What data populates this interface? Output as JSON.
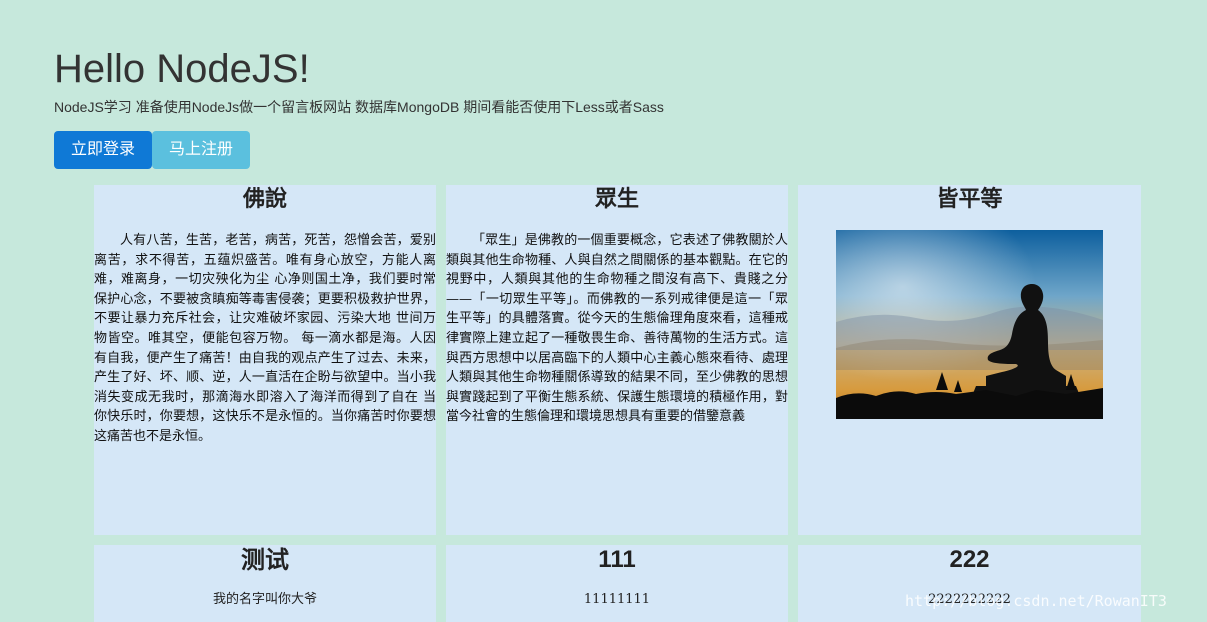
{
  "hero": {
    "title": "Hello NodeJS!",
    "subtitle": "NodeJS学习 准备使用NodeJs做一个留言板网站 数据库MongoDB 期间看能否使用下Less或者Sass"
  },
  "buttons": {
    "login": "立即登录",
    "register": "马上注册"
  },
  "colors": {
    "background": "#c6e8dc",
    "card": "#d5e7f7",
    "primary": "#0f79d6",
    "info": "#5bc0de"
  },
  "cards": [
    {
      "title": "佛說",
      "text": "人有八苦，生苦，老苦，病苦，死苦，怨憎会苦，爱别离苦，求不得苦，五蕴炽盛苦。唯有身心放空，方能人离难，难离身，一切灾殃化为尘  心净则国土净，我们要时常保护心念，不要被贪瞋痴等毒害侵袭；更要积极救护世界，不要让暴力充斥社会，让灾难破坏家园、污染大地  世间万物皆空。唯其空，便能包容万物。  每一滴水都是海。人因有自我，便产生了痛苦！由自我的观点产生了过去、未来，产生了好、坏、顺、逆，人一直活在企盼与欲望中。当小我消失变成无我时，那滴海水即溶入了海洋而得到了自在  当你快乐时，你要想，这快乐不是永恒的。当你痛苦时你要想这痛苦也不是永恒。"
    },
    {
      "title": "眾生",
      "text": "「眾生」是佛教的一個重要概念，它表述了佛教關於人類與其他生命物種、人與自然之間關係的基本觀點。在它的視野中，人類與其他的生命物種之間沒有高下、貴賤之分——「一切眾生平等」。而佛教的一系列戒律便是這一「眾生平等」的具體落實。從今天的生態倫理角度來看，這種戒律實際上建立起了一種敬畏生命、善待萬物的生活方式。這與西方思想中以居高臨下的人類中心主義心態來看待、處理人類與其他生命物種關係導致的結果不同，至少佛教的思想與實踐起到了平衡生態系統、保護生態環境的積極作用，對當今社會的生態倫理和環境思想具有重要的借鑒意義"
    },
    {
      "title": "皆平等",
      "image_alt": "buddha-silhouette"
    },
    {
      "title": "测试",
      "text": "我的名字叫你大爷"
    },
    {
      "title": "111",
      "text": "11111111"
    },
    {
      "title": "222",
      "text": "2222222222"
    }
  ],
  "watermark": "http://blog.csdn.net/RowanIT3"
}
